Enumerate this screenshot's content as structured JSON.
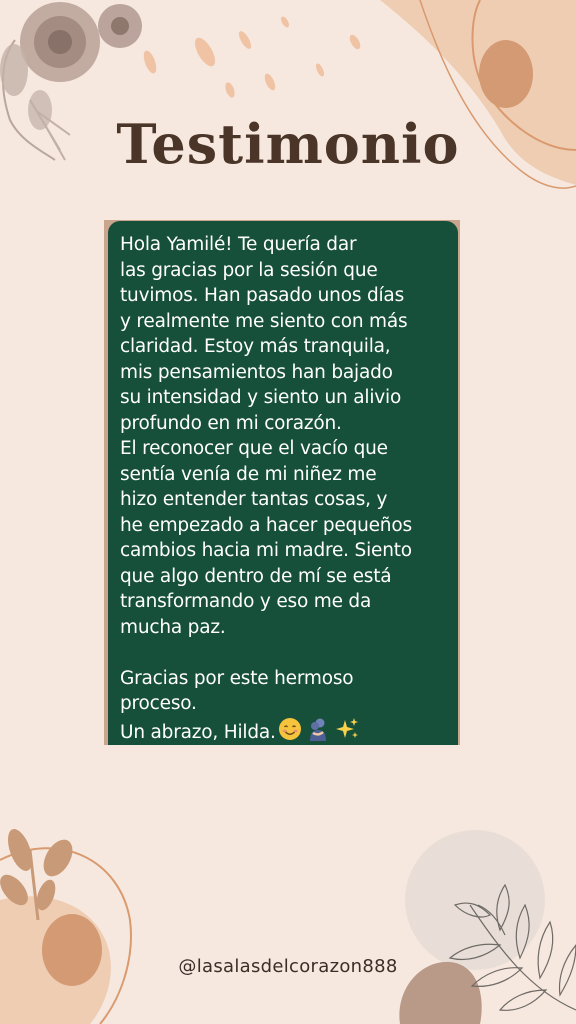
{
  "title": "Testimonio",
  "message": {
    "lines": [
      "Hola Yamilé! Te quería dar",
      "las gracias por la sesión que",
      "tuvimos. Han pasado unos días",
      "y realmente me siento con más",
      "claridad. Estoy más tranquila,",
      "mis pensamientos han bajado",
      "su intensidad y siento un alivio",
      "profundo en mi corazón.",
      "El reconocer que el vacío que",
      "sentía venía de mi niñez me",
      "hizo entender tantas cosas, y",
      "he empezado a hacer pequeños",
      "cambios hacia mi madre. Siento",
      "que algo dentro de mí se está",
      "transformando y eso me da",
      "mucha paz."
    ],
    "closing_lines": [
      "Gracias por este hermoso",
      "proceso."
    ],
    "signature": "Un abrazo, Hilda.",
    "emojis": [
      "smiling-face-emoji",
      "people-hugging-emoji",
      "sparkles-emoji"
    ]
  },
  "handle": "@lasalasdelcorazon888",
  "colors": {
    "background": "#f6e8de",
    "title": "#4a3528",
    "card": "#17503a",
    "card_text": "#ffffff",
    "accent_peach": "#e9bfa0",
    "accent_brown": "#c99a78"
  }
}
